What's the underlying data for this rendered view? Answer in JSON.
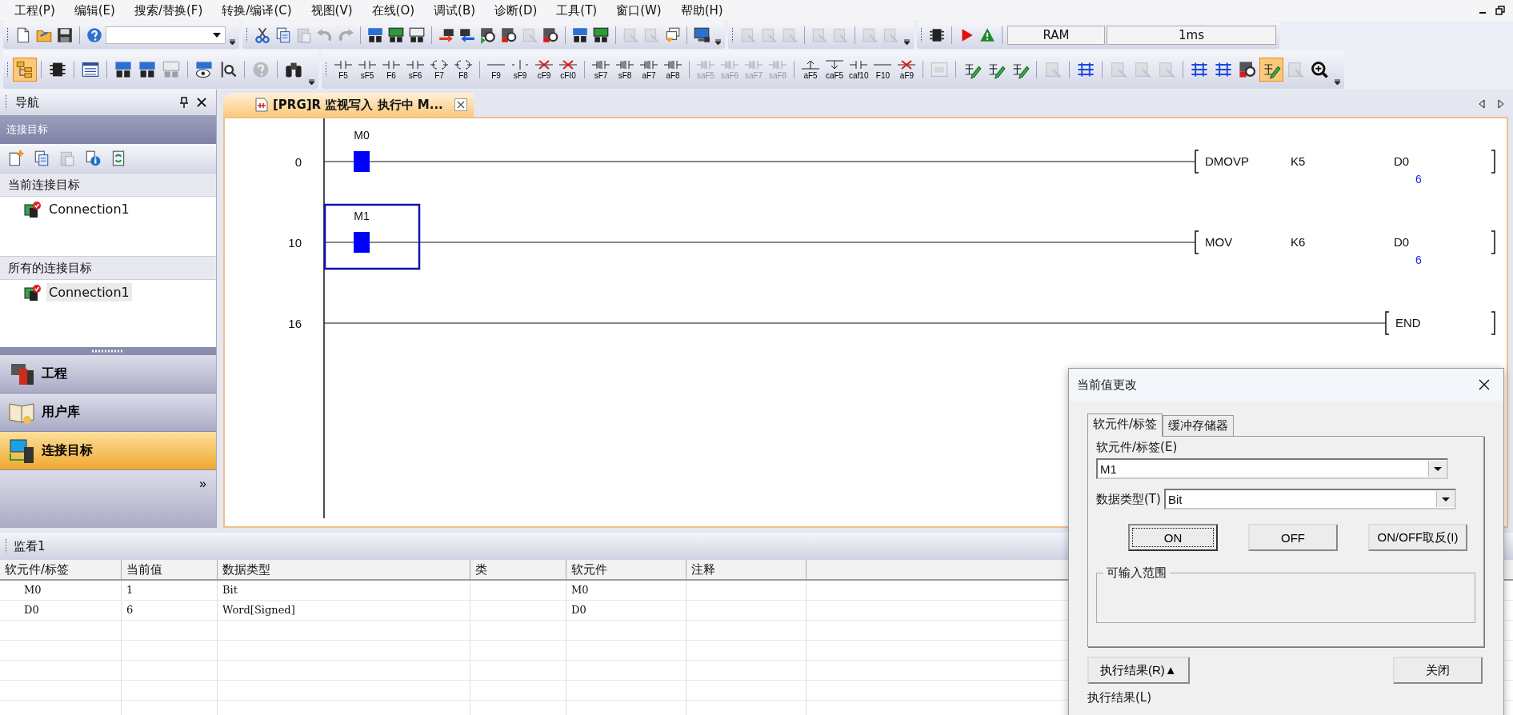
{
  "menu": [
    {
      "label": "工程(P)"
    },
    {
      "label": "编辑(E)"
    },
    {
      "label": "搜索/替换(F)"
    },
    {
      "label": "转换/编译(C)"
    },
    {
      "label": "视图(V)"
    },
    {
      "label": "在线(O)"
    },
    {
      "label": "调试(B)"
    },
    {
      "label": "诊断(D)"
    },
    {
      "label": "工具(T)"
    },
    {
      "label": "窗口(W)"
    },
    {
      "label": "帮助(H)"
    }
  ],
  "toolbar_row1": [
    [
      [
        {
          "kind": "doc",
          "disabled": false
        },
        {
          "kind": "folder",
          "disabled": false
        },
        {
          "kind": "disk",
          "disabled": false
        }
      ],
      [
        {
          "kind": "help",
          "disabled": false
        },
        {
          "kind": "combo",
          "disabled": false
        }
      ]
    ],
    [
      [
        {
          "kind": "scissors",
          "disabled": false
        },
        {
          "kind": "copy",
          "disabled": false
        },
        {
          "kind": "paste",
          "disabled": true
        },
        {
          "kind": "undo",
          "disabled": true
        },
        {
          "kind": "redo",
          "disabled": true
        }
      ],
      [
        {
          "kind": "dev",
          "disabled": false
        },
        {
          "kind": "devg",
          "disabled": false
        },
        {
          "kind": "devk",
          "disabled": false
        }
      ],
      [
        {
          "kind": "arrowr",
          "disabled": false
        },
        {
          "kind": "arrowb",
          "disabled": false
        },
        {
          "kind": "magg",
          "disabled": false
        },
        {
          "kind": "magr",
          "disabled": false
        },
        {
          "kind": "box",
          "disabled": true
        },
        {
          "kind": "magr",
          "disabled": false
        }
      ],
      [
        {
          "kind": "dev",
          "disabled": false
        },
        {
          "kind": "devg",
          "disabled": false
        }
      ],
      [
        {
          "kind": "box",
          "disabled": true
        },
        {
          "kind": "box",
          "disabled": true
        },
        {
          "kind": "pages",
          "disabled": false
        }
      ],
      [
        {
          "kind": "monitor",
          "disabled": false
        }
      ]
    ],
    [
      [
        {
          "kind": "box",
          "disabled": true
        },
        {
          "kind": "box",
          "disabled": true
        },
        {
          "kind": "box",
          "disabled": true
        }
      ],
      [
        {
          "kind": "box",
          "disabled": true
        },
        {
          "kind": "box",
          "disabled": true
        }
      ],
      [
        {
          "kind": "box",
          "disabled": true
        },
        {
          "kind": "box",
          "disabled": true
        }
      ]
    ],
    [
      [
        {
          "kind": "chip",
          "disabled": false
        }
      ],
      [
        {
          "kind": "play",
          "disabled": false
        },
        {
          "kind": "warn",
          "disabled": false
        }
      ]
    ]
  ],
  "status_fields": [
    {
      "text": "RAM"
    },
    {
      "text": "1ms"
    }
  ],
  "toolbar_row2": [
    [
      [
        {
          "kind": "tree",
          "disabled": false,
          "on": true
        }
      ],
      [
        {
          "kind": "chip",
          "disabled": false,
          "on": false
        }
      ],
      [
        {
          "kind": "list",
          "disabled": false,
          "on": false
        }
      ],
      [
        {
          "kind": "dev",
          "disabled": false,
          "on": false
        },
        {
          "kind": "dev",
          "disabled": false,
          "on": false
        },
        {
          "kind": "devk",
          "disabled": true,
          "on": false
        }
      ],
      [
        {
          "kind": "eye",
          "disabled": false,
          "on": false
        },
        {
          "kind": "search",
          "disabled": false,
          "on": false
        }
      ],
      [
        {
          "kind": "help",
          "disabled": true,
          "on": false
        }
      ],
      [
        {
          "kind": "binoc",
          "disabled": false,
          "on": false
        }
      ]
    ],
    [
      [
        {
          "kind": "contact",
          "label": "F5",
          "disabled": false,
          "on": false
        },
        {
          "kind": "contact",
          "label": "sF5",
          "disabled": false,
          "on": false
        },
        {
          "kind": "contact",
          "label": "F6",
          "disabled": false,
          "on": false
        },
        {
          "kind": "contact",
          "label": "sF6",
          "disabled": false,
          "on": false
        },
        {
          "kind": "coil",
          "label": "F7",
          "disabled": false,
          "on": false
        },
        {
          "kind": "coil",
          "label": "F8",
          "disabled": false,
          "on": false
        }
      ],
      [
        {
          "kind": "hline",
          "label": "F9",
          "disabled": false,
          "on": false
        },
        {
          "kind": "vline",
          "label": "sF9",
          "disabled": false,
          "on": false
        },
        {
          "kind": "delete",
          "label": "cF9",
          "disabled": false,
          "on": false
        },
        {
          "kind": "delete",
          "label": "cFI0",
          "disabled": false,
          "on": false
        }
      ],
      [
        {
          "kind": "pulse",
          "label": "sF7",
          "disabled": false,
          "on": false
        },
        {
          "kind": "pulse",
          "label": "sF8",
          "disabled": false,
          "on": false
        },
        {
          "kind": "pulse",
          "label": "aF7",
          "disabled": false,
          "on": false
        },
        {
          "kind": "pulse",
          "label": "aF8",
          "disabled": false,
          "on": false
        }
      ],
      [
        {
          "kind": "pulse",
          "label": "saF5",
          "disabled": true,
          "on": false
        },
        {
          "kind": "pulse",
          "label": "saF6",
          "disabled": true,
          "on": false
        },
        {
          "kind": "pulse",
          "label": "saF7",
          "disabled": true,
          "on": false
        },
        {
          "kind": "pulse",
          "label": "saF8",
          "disabled": true,
          "on": false
        }
      ],
      [
        {
          "kind": "up",
          "label": "aF5",
          "disabled": false,
          "on": false
        },
        {
          "kind": "down",
          "label": "caF5",
          "disabled": false,
          "on": false
        },
        {
          "kind": "contact",
          "label": "caf10",
          "disabled": false,
          "on": false
        },
        {
          "kind": "hline",
          "label": "F10",
          "disabled": false,
          "on": false
        },
        {
          "kind": "delete",
          "label": "aF9",
          "disabled": false,
          "on": false
        }
      ],
      [
        {
          "kind": "st",
          "disabled": true,
          "on": false
        }
      ],
      [
        {
          "kind": "pencil",
          "disabled": false,
          "on": false
        },
        {
          "kind": "pencil",
          "disabled": false,
          "on": false
        },
        {
          "kind": "pencil",
          "disabled": false,
          "on": false
        }
      ],
      [
        {
          "kind": "box",
          "disabled": true,
          "on": false
        }
      ],
      [
        {
          "kind": "blines",
          "disabled": false,
          "on": false
        }
      ],
      [
        {
          "kind": "box",
          "disabled": true,
          "on": false
        },
        {
          "kind": "box",
          "disabled": true,
          "on": false
        },
        {
          "kind": "box",
          "disabled": true,
          "on": false
        }
      ],
      [
        {
          "kind": "blines",
          "disabled": false,
          "on": false
        },
        {
          "kind": "blines",
          "disabled": false,
          "on": false
        },
        {
          "kind": "magr",
          "disabled": false,
          "on": false
        },
        {
          "kind": "pencil",
          "disabled": false,
          "on": true
        },
        {
          "kind": "box",
          "disabled": true,
          "on": false
        },
        {
          "kind": "zoom",
          "disabled": false,
          "on": false
        }
      ]
    ]
  ],
  "navigation": {
    "title": "导航",
    "section": "连接目标",
    "tools": [
      {
        "kind": "new",
        "disabled": false
      },
      {
        "kind": "copy",
        "disabled": false
      },
      {
        "kind": "paste",
        "disabled": true
      },
      {
        "kind": "info",
        "disabled": false
      },
      {
        "kind": "refresh",
        "disabled": false
      }
    ],
    "current_header": "当前连接目标",
    "current_items": [
      {
        "label": "Connection1",
        "selected": false
      }
    ],
    "all_header": "所有的连接目标",
    "all_items": [
      {
        "label": "Connection1",
        "selected": true
      }
    ],
    "views": [
      {
        "kind": "project",
        "label": "工程",
        "selected": false
      },
      {
        "kind": "library",
        "label": "用户库",
        "selected": false
      },
      {
        "kind": "connection",
        "label": "连接目标",
        "selected": true
      }
    ],
    "more": "»"
  },
  "editor": {
    "tab": {
      "label": "[PRG]R 监视写入 执行中 M...",
      "selected": true
    },
    "rungs": [
      {
        "step": "0",
        "contact": {
          "label": "M0",
          "on": true
        },
        "selected": false,
        "instruction": {
          "op": "DMOVP",
          "args": [
            "K5",
            "D0"
          ],
          "value": "6"
        }
      },
      {
        "step": "10",
        "contact": {
          "label": "M1",
          "on": true
        },
        "selected": true,
        "instruction": {
          "op": "MOV",
          "args": [
            "K6",
            "D0"
          ],
          "value": "6"
        }
      },
      {
        "step": "16",
        "selected": false,
        "instruction": {
          "op": "END"
        }
      }
    ]
  },
  "watch": {
    "title": "监看1",
    "columns": [
      "软元件/标签",
      "当前值",
      "数据类型",
      "类",
      "软元件",
      "注释"
    ],
    "rows": [
      [
        "M0",
        "1",
        "Bit",
        "",
        "M0",
        ""
      ],
      [
        "D0",
        "6",
        "Word[Signed]",
        "",
        "D0",
        ""
      ]
    ]
  },
  "dialog": {
    "title": "当前值更改",
    "tabs": [
      {
        "label": "软元件/标签",
        "selected": true
      },
      {
        "label": "缓冲存储器",
        "selected": false
      }
    ],
    "device_label": "软元件/标签(E)",
    "device_value": "M1",
    "type_label": "数据类型(T)",
    "type_value": "Bit",
    "buttons": [
      {
        "label": "ON",
        "focused": true
      },
      {
        "label": "OFF",
        "focused": false
      },
      {
        "label": "ON/OFF取反(I)",
        "focused": false
      }
    ],
    "range_label": "可输入范围",
    "result_button": "执行结果(R)▲",
    "close_button": "关闭",
    "result_label": "执行结果(L)"
  }
}
